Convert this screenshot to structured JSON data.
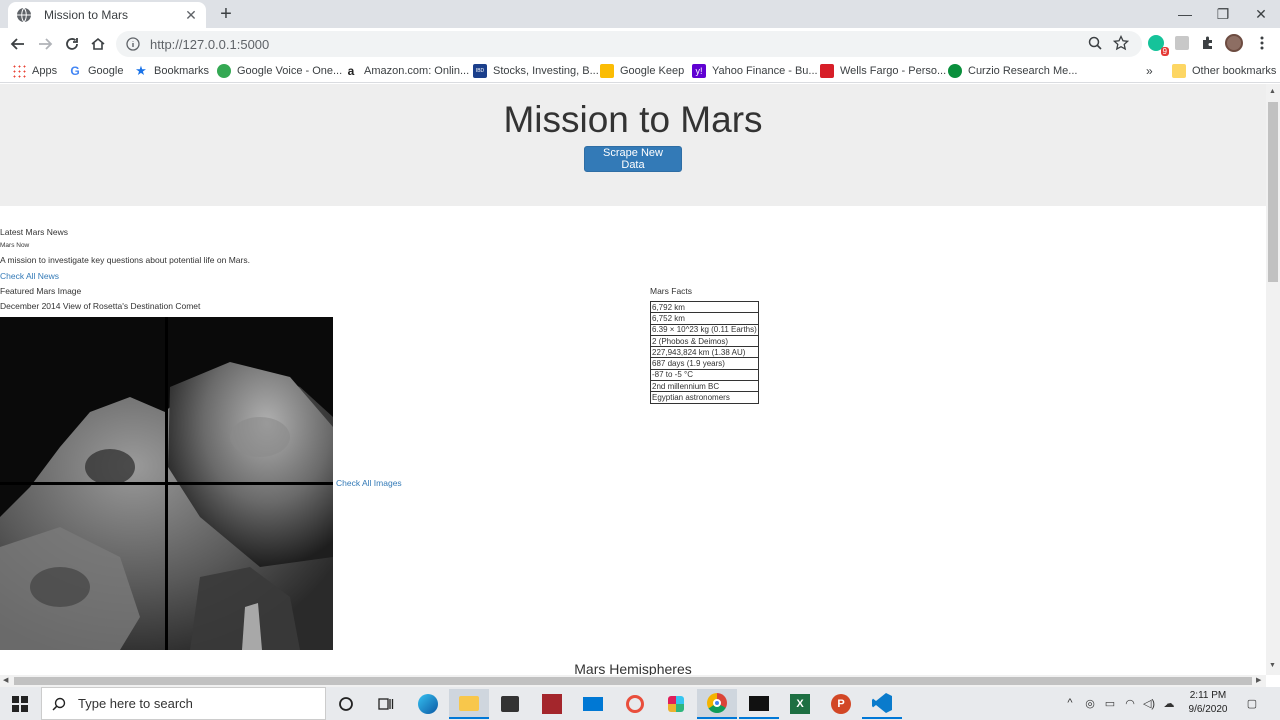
{
  "browser": {
    "tab_title": "Mission to Mars",
    "url": "http://127.0.0.1:5000",
    "extension_badge": "9"
  },
  "bookmarks": [
    {
      "label": "Apps",
      "icon": "apps-grid-icon",
      "color": "#ea4335"
    },
    {
      "label": "Google",
      "icon": "google-icon",
      "color": "#4285f4"
    },
    {
      "label": "Bookmarks",
      "icon": "star-icon",
      "color": "#1a73e8"
    },
    {
      "label": "Google Voice - One...",
      "icon": "google-voice-icon",
      "color": "#34a853"
    },
    {
      "label": "Amazon.com: Onlin...",
      "icon": "amazon-icon",
      "color": "#222222"
    },
    {
      "label": "Stocks, Investing, B...",
      "icon": "ibd-icon",
      "color": "#1b3f8b"
    },
    {
      "label": "Google Keep",
      "icon": "google-keep-icon",
      "color": "#fbbc04"
    },
    {
      "label": "Yahoo Finance - Bu...",
      "icon": "yahoo-icon",
      "color": "#6001d2"
    },
    {
      "label": "Wells Fargo - Perso...",
      "icon": "wells-fargo-icon",
      "color": "#d71e28"
    },
    {
      "label": "Curzio Research Me...",
      "icon": "curzio-icon",
      "color": "#0a8f3c"
    }
  ],
  "bookmarks_overflow": "»",
  "other_bookmarks": "Other bookmarks",
  "page": {
    "title": "Mission to Mars",
    "scrape_button": "Scrape New Data",
    "news_heading": "Latest Mars News",
    "news_title": "Mars Now",
    "news_paragraph": "A mission to investigate key questions about potential life on Mars.",
    "news_link": "Check All News",
    "image_heading": "Featured Mars Image",
    "image_caption": "December 2014 View of Rosetta's Destination Comet",
    "image_link": "Check All Images",
    "facts_heading": "Mars Facts",
    "facts": [
      "6,792 km",
      "6,752 km",
      "6.39 × 10^23 kg (0.11 Earths)",
      "2 (Phobos & Deimos)",
      "227,943,824 km (1.38 AU)",
      "687 days (1.9 years)",
      "-87 to -5 °C",
      "2nd millennium BC",
      "Egyptian astronomers"
    ],
    "hemispheres_heading": "Mars Hemispheres"
  },
  "taskbar": {
    "search_placeholder": "Type here to search",
    "time": "2:11 PM",
    "date": "9/6/2020"
  },
  "colors": {
    "accent": "#337ab7",
    "jumbotron_bg": "#eeeeee"
  }
}
